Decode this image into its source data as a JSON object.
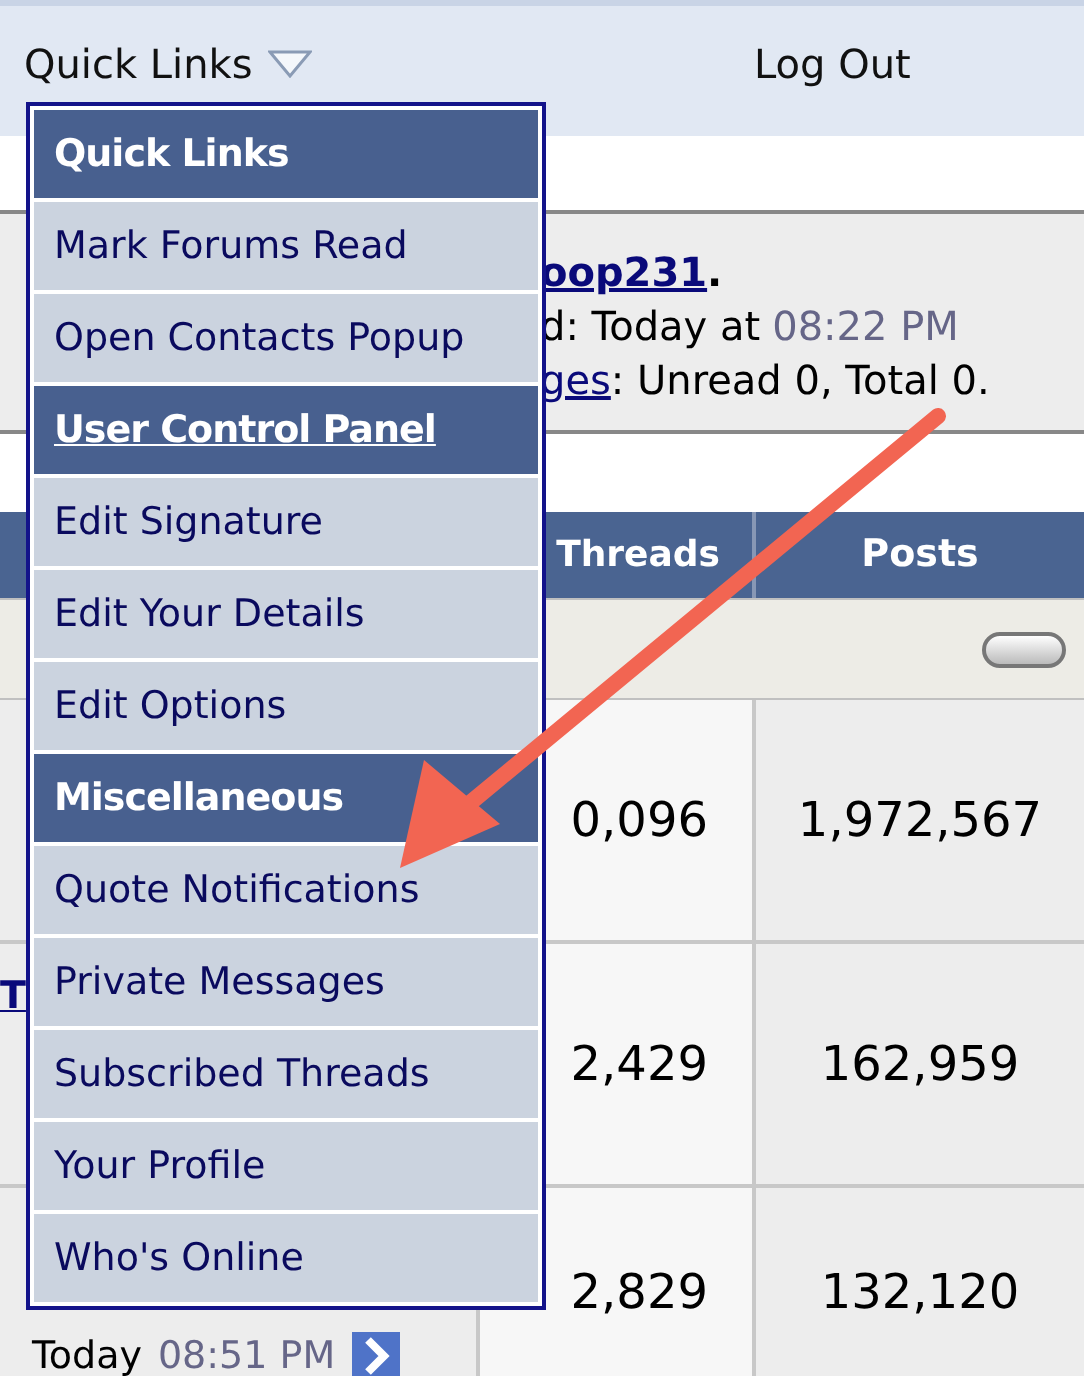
{
  "nav_bar": {
    "quick_links": "Quick Links",
    "log_out": "Log Out"
  },
  "welcome": {
    "user_link": "oop231",
    "user_end": ".",
    "last_visit": "d: Today at",
    "last_visit_time": "08:22 PM",
    "messages_link": "ges",
    "messages_text": ": Unread 0, Total 0."
  },
  "table": {
    "columns": [
      "Threads",
      "Posts"
    ],
    "rows": [
      {
        "kind": "category"
      },
      {
        "kind": "forum",
        "threads": "0,096",
        "posts": "1,972,567"
      },
      {
        "kind": "forum",
        "forum": "T",
        "threads": "2,429",
        "posts": "162,959"
      },
      {
        "kind": "forum",
        "threads": "2,829",
        "posts": "132,120",
        "last_post": "Today",
        "last_post_time": "08:51 PM"
      }
    ]
  },
  "menu": {
    "items": [
      {
        "kind": "header",
        "label": "Quick Links"
      },
      {
        "kind": "item",
        "label": "Mark Forums Read"
      },
      {
        "kind": "item",
        "label": "Open Contacts Popup"
      },
      {
        "kind": "header_link",
        "label": "User Control Panel"
      },
      {
        "kind": "item",
        "label": "Edit Signature"
      },
      {
        "kind": "item",
        "label": "Edit Your Details"
      },
      {
        "kind": "item",
        "label": "Edit Options"
      },
      {
        "kind": "header",
        "label": "Miscellaneous"
      },
      {
        "kind": "item",
        "label": "Quote Notifications"
      },
      {
        "kind": "item",
        "label": "Private Messages"
      },
      {
        "kind": "item",
        "label": "Subscribed Threads"
      },
      {
        "kind": "item",
        "label": "Your Profile"
      },
      {
        "kind": "item",
        "label": "Who's Online"
      }
    ]
  }
}
